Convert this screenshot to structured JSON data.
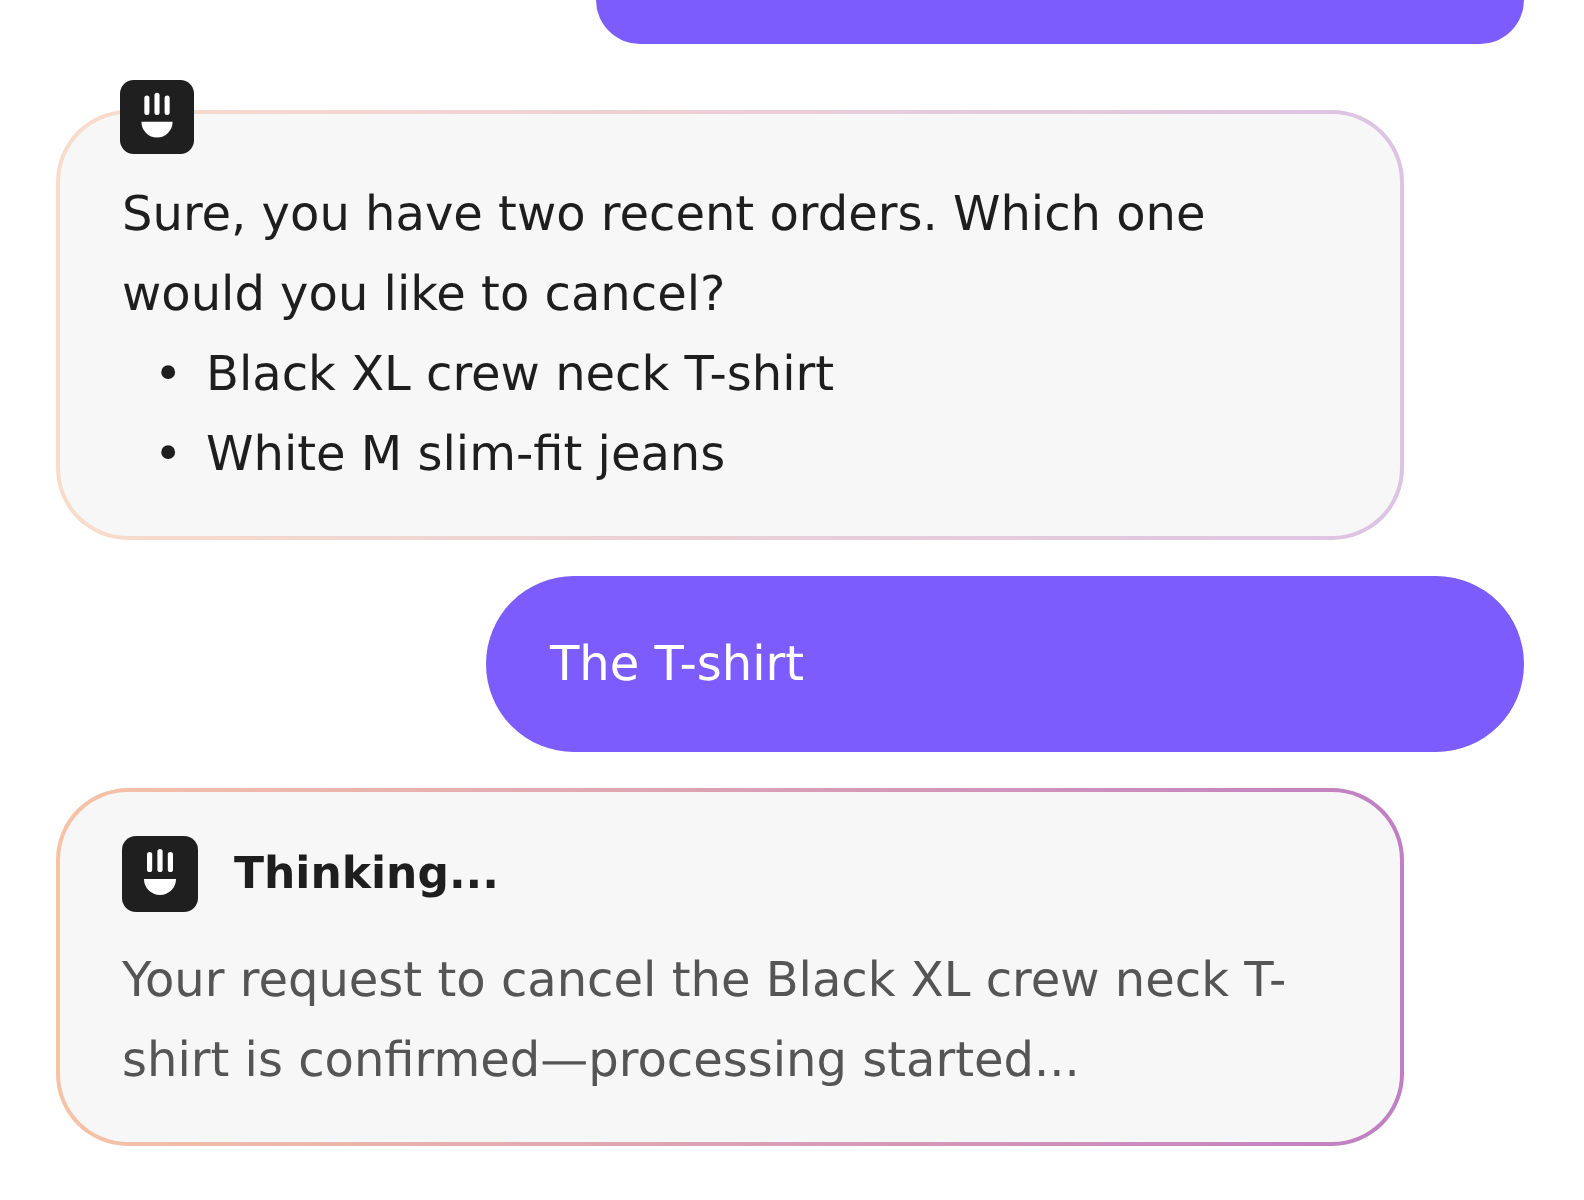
{
  "messages": [
    {
      "kind": "user"
    },
    {
      "kind": "bot",
      "text": "Sure, you have two recent orders. Which one would you like to cancel?",
      "items": [
        {
          "marker": "•",
          "text": "Black XL crew neck T-shirt"
        },
        {
          "marker": "•",
          "text": "White M slim-fit jeans"
        }
      ]
    },
    {
      "kind": "user",
      "text": "The T-shirt"
    },
    {
      "kind": "thinking",
      "status": "Thinking...",
      "text": "Your request to cancel the Black XL crew neck T-shirt is confirmed—processing started..."
    }
  ]
}
